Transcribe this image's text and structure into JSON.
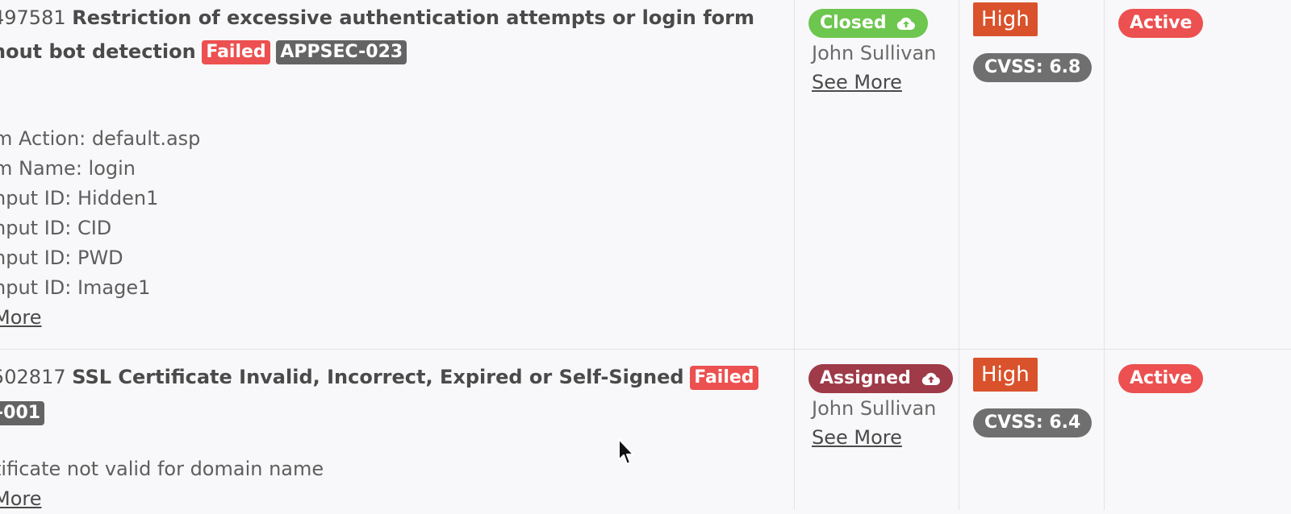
{
  "rows": [
    {
      "id_fragment": "497581",
      "title": "Restriction of excessive authentication attempts or login form",
      "title_line2": "hout bot detection",
      "result_tag": "Failed",
      "ref_tag": "APPSEC-023",
      "details": [
        "m Action: default.asp",
        "m Name: login",
        "nput ID: Hidden1",
        "nput ID: CID",
        "nput ID: PWD",
        "nput ID: Image1"
      ],
      "details_link": "More",
      "status": "Closed",
      "status_icon": "cloud-upload-icon",
      "assignee": "John Sullivan",
      "see_more": "See More",
      "severity": "High",
      "cvss": "CVSS: 6.8",
      "state": "Active"
    },
    {
      "id_fragment": "502817",
      "title": "SSL Certificate Invalid, Incorrect, Expired or Self-Signed",
      "result_tag": "Failed",
      "ref_tag": "-001",
      "details": [
        "tificate not valid for domain name"
      ],
      "details_link": "More",
      "status": "Assigned",
      "status_icon": "cloud-upload-icon",
      "assignee": "John Sullivan",
      "see_more": "See More",
      "severity": "High",
      "cvss": "CVSS: 6.4",
      "state": "Active"
    }
  ],
  "colors": {
    "closed": "#6dc64e",
    "assigned": "#9f3a48",
    "failed": "#ec5050",
    "active": "#ec5050",
    "severity_high": "#d9522c",
    "cvss": "#6f6f6f"
  }
}
